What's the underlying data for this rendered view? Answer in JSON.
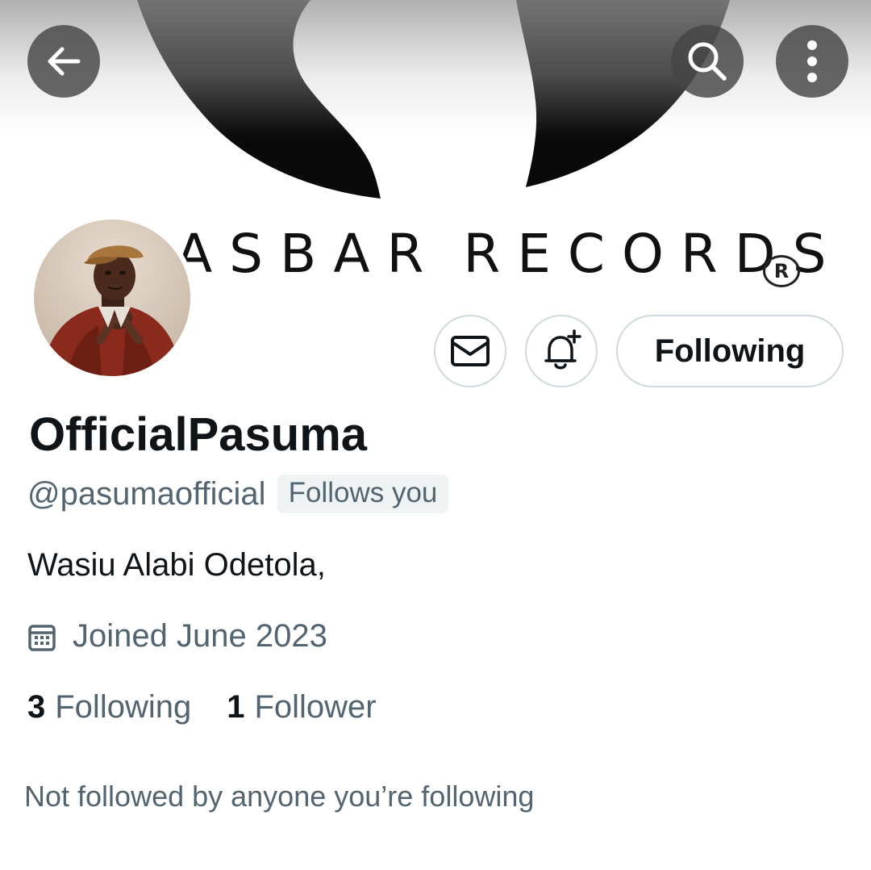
{
  "banner": {
    "text_left": "ASBAR",
    "text_right": "RECORDS",
    "registered_mark": "R"
  },
  "nav": {
    "back_icon": "arrow-left-icon",
    "search_icon": "search-icon",
    "more_icon": "more-vertical-icon"
  },
  "actions": {
    "message_icon": "envelope-icon",
    "notify_icon": "bell-plus-icon",
    "follow_label": "Following"
  },
  "profile": {
    "display_name": "OfficialPasuma",
    "handle": "@pasumaofficial",
    "follows_you": "Follows you",
    "bio": "Wasiu Alabi Odetola,",
    "joined": "Joined June 2023",
    "joined_icon": "calendar-icon",
    "following_count": "3",
    "following_label": "Following",
    "followers_count": "1",
    "followers_label": "Follower",
    "mutuals_note": "Not followed by anyone you’re following"
  },
  "colors": {
    "primary_text": "#0f1419",
    "secondary_text": "#536471",
    "border": "#cfd9de",
    "badge_bg": "#eff3f4"
  }
}
